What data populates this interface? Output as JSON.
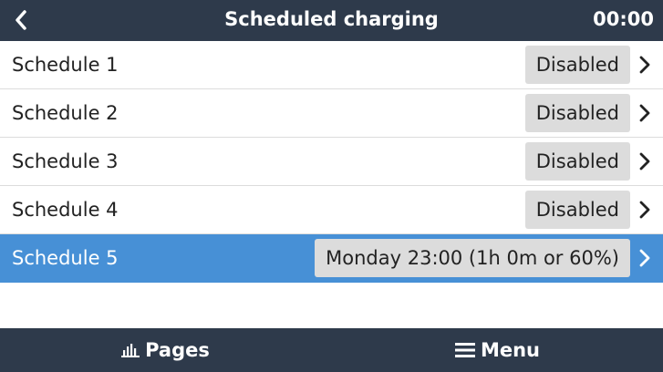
{
  "header": {
    "title": "Scheduled charging",
    "time": "00:00",
    "back_icon": "chevron-left-icon"
  },
  "schedules": [
    {
      "label": "Schedule 1",
      "value": "Disabled"
    },
    {
      "label": "Schedule 2",
      "value": "Disabled"
    },
    {
      "label": "Schedule 3",
      "value": "Disabled"
    },
    {
      "label": "Schedule 4",
      "value": "Disabled"
    },
    {
      "label": "Schedule 5",
      "value": "Monday 23:00 (1h 0m or 60%)"
    }
  ],
  "selected_index": 4,
  "footer": {
    "pages_label": "Pages",
    "pages_icon": "bar-chart-icon",
    "menu_label": "Menu",
    "menu_icon": "hamburger-menu-icon"
  },
  "colors": {
    "bar_background": "#2e3a4b",
    "selected_row": "#4790d6",
    "value_box": "#dcdcdc"
  }
}
